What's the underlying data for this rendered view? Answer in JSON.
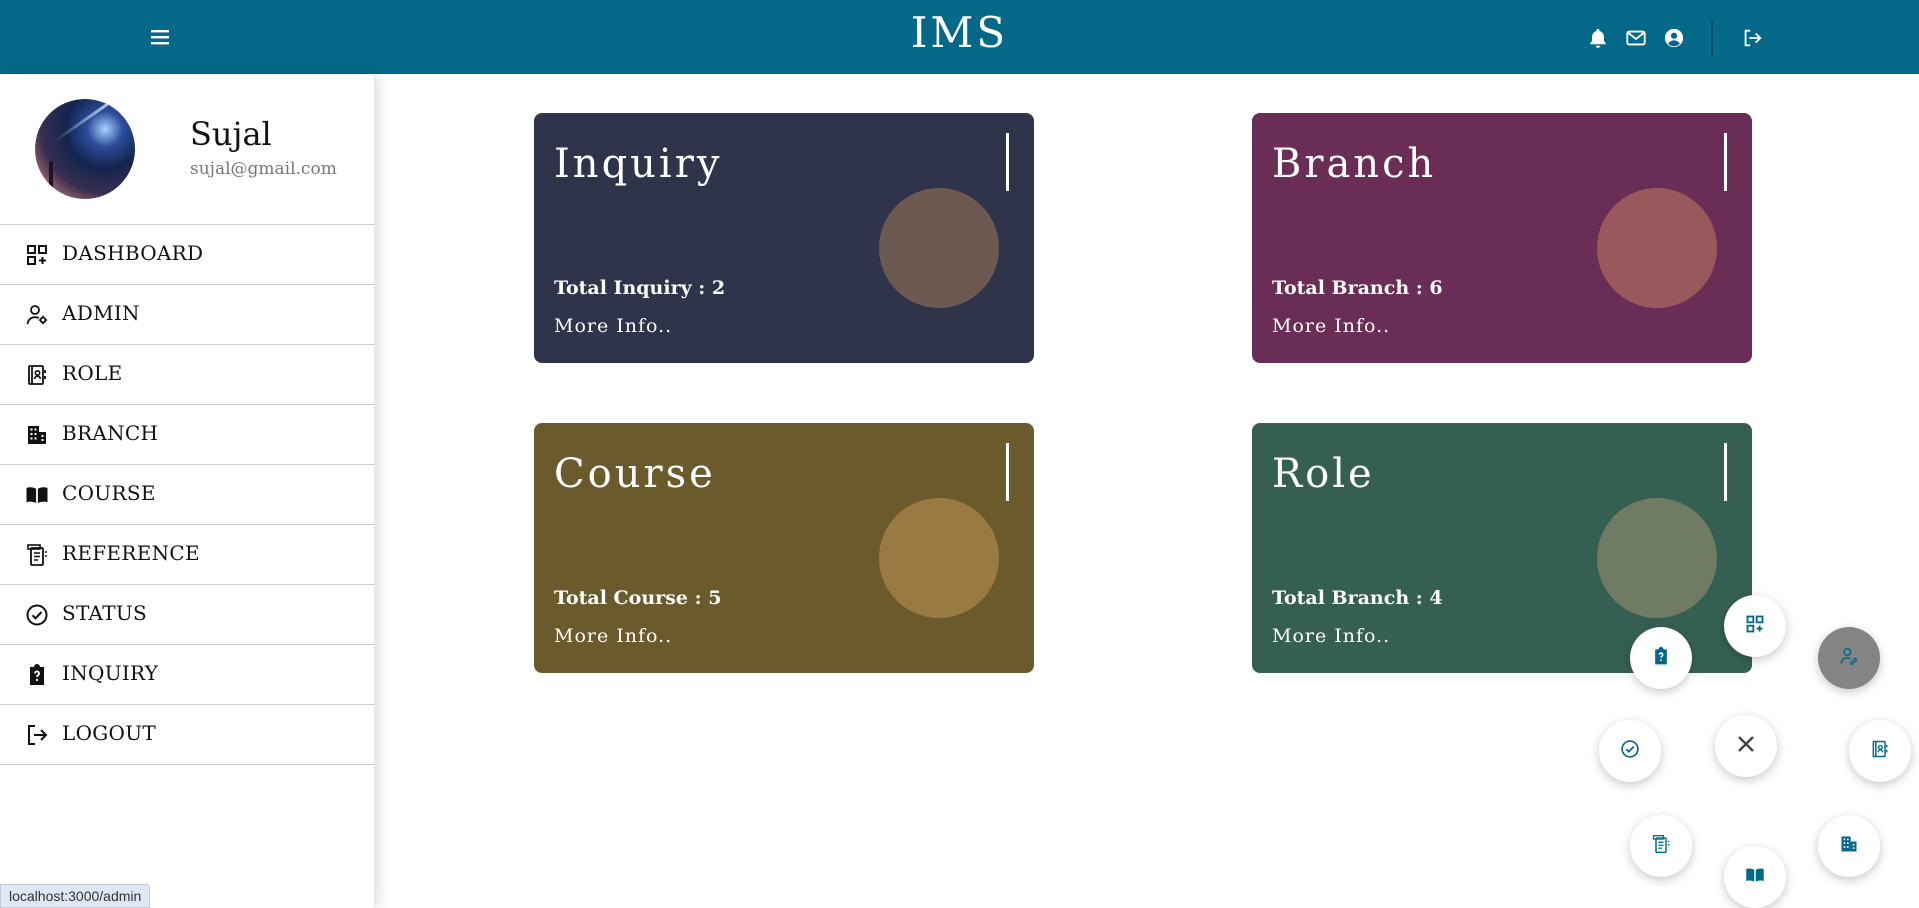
{
  "header": {
    "title": "IMS",
    "icons": [
      "menu-icon",
      "bell-icon",
      "mail-icon",
      "user-circle-icon",
      "logout-icon"
    ],
    "background": "#046888"
  },
  "profile": {
    "name": "Sujal",
    "email": "sujal@gmail.com"
  },
  "sidebar": {
    "items": [
      {
        "label": "DASHBOARD",
        "icon": "dashboard-icon"
      },
      {
        "label": "ADMIN",
        "icon": "admin-icon"
      },
      {
        "label": "ROLE",
        "icon": "role-icon"
      },
      {
        "label": "BRANCH",
        "icon": "branch-icon"
      },
      {
        "label": "COURSE",
        "icon": "course-icon"
      },
      {
        "label": "REFERENCE",
        "icon": "reference-icon"
      },
      {
        "label": "STATUS",
        "icon": "status-icon"
      },
      {
        "label": "INQUIRY",
        "icon": "inquiry-icon"
      },
      {
        "label": "LOGOUT",
        "icon": "logout-icon"
      }
    ]
  },
  "cards": [
    {
      "title": "Inquiry",
      "total": "Total Inquiry : 2",
      "more": "More Info..",
      "color": "#30344b",
      "circle": "#6c5a52"
    },
    {
      "title": "Branch",
      "total": "Total Branch : 6",
      "more": "More Info..",
      "color": "#6a2d55",
      "circle": "#99585c"
    },
    {
      "title": "Course",
      "total": "Total Course : 5",
      "more": "More Info..",
      "color": "#6b5b2c",
      "circle": "#997a43"
    },
    {
      "title": "Role",
      "total": "Total Branch : 4",
      "more": "More Info..",
      "color": "#365f54",
      "circle": "#6f7b62"
    }
  ],
  "fab_menu": {
    "items": [
      "dashboard-icon",
      "inquiry-icon",
      "status-icon",
      "reference-icon",
      "course-icon",
      "branch-icon",
      "role-icon",
      "admin-icon"
    ],
    "close_icon": "close-icon"
  },
  "status_bar": {
    "url": "localhost:3000/admin"
  }
}
